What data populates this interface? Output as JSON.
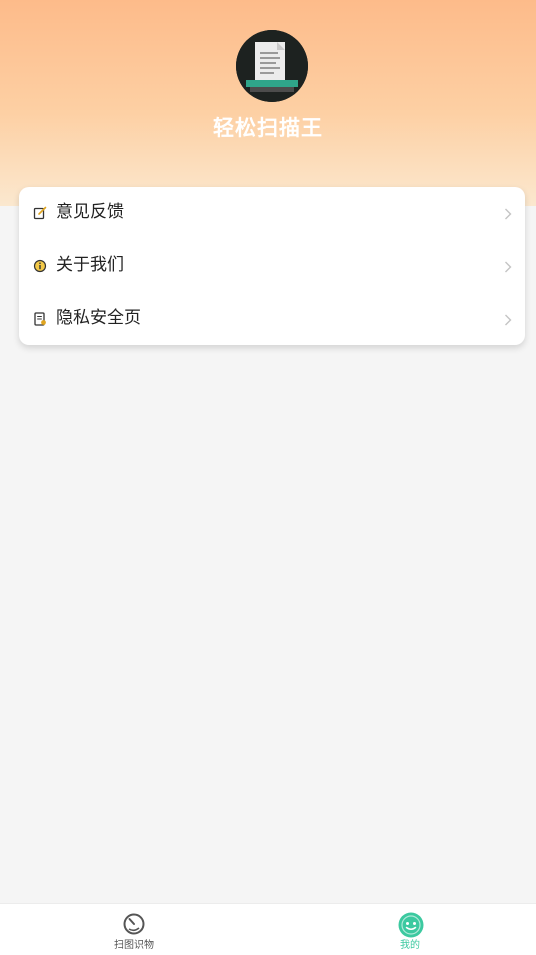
{
  "app": {
    "name": "轻松扫描王"
  },
  "menu": {
    "items": [
      {
        "label": "意见反馈",
        "icon": "feedback-edit-icon"
      },
      {
        "label": "关于我们",
        "icon": "info-icon"
      },
      {
        "label": "隐私安全页",
        "icon": "privacy-document-icon"
      }
    ]
  },
  "tabbar": {
    "tabs": [
      {
        "label": "扫图识物",
        "icon": "scan-timer-icon",
        "active": false
      },
      {
        "label": "我的",
        "icon": "smiley-face-icon",
        "active": true
      }
    ]
  },
  "colors": {
    "accent": "#3cc9a0",
    "inactive": "#555555",
    "header_top": "#fdbb8a",
    "header_bottom": "#fbe8cf",
    "icon_amber": "#e0a520"
  }
}
